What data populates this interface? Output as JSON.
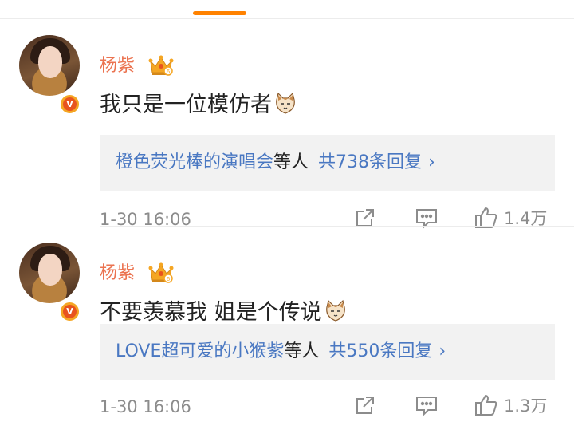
{
  "comments": [
    {
      "username": "杨紫",
      "text": "我只是一位模仿者",
      "reply_names": "橙色荧光棒的演唱会",
      "reply_etc": "等人",
      "reply_count": "共738条回复",
      "reply_arrow": "›",
      "time": "1-30 16:06",
      "likes": "1.4万"
    },
    {
      "username": "杨紫",
      "text": "不要羡慕我 姐是个传说",
      "reply_names": "LOVE超可爱的小猴紫",
      "reply_etc": "等人",
      "reply_count": "共550条回复",
      "reply_arrow": "›",
      "time": "1-30 16:06",
      "likes": "1.3万"
    }
  ],
  "icons": {
    "badge": "verified-v-badge",
    "crown": "crown-vip-icon",
    "emoji": "cat-emoji",
    "forward": "forward-icon",
    "comment": "comment-icon",
    "like": "thumbs-up-icon"
  },
  "colors": {
    "accent": "#ff8200",
    "username": "#eb7350",
    "link": "#4a78c2",
    "meta": "#8c8c8c",
    "reply_bg": "#f2f2f2"
  }
}
